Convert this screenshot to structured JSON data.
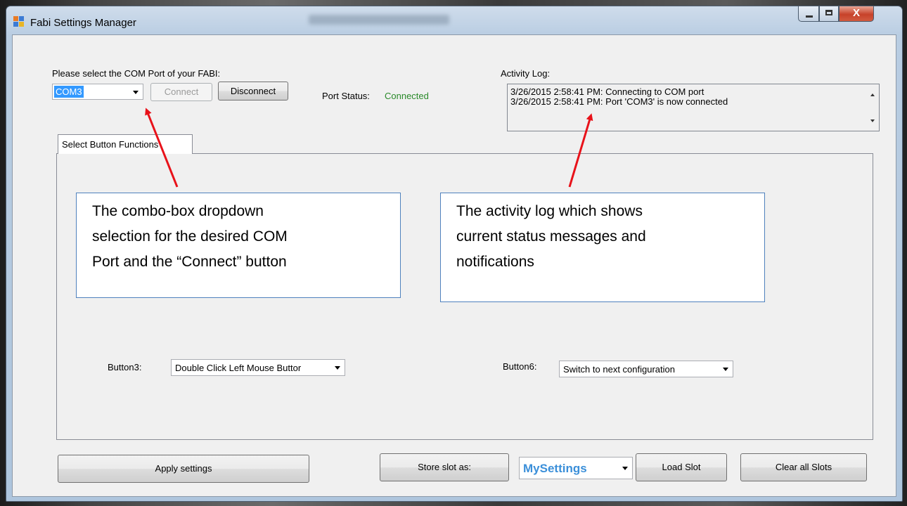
{
  "window": {
    "title": "Fabi Settings Manager",
    "close_glyph": "X"
  },
  "port": {
    "prompt": "Please select the COM Port of your FABI:",
    "selected": "COM3",
    "connect_label": "Connect",
    "disconnect_label": "Disconnect",
    "status_label": "Port Status:",
    "status_value": "Connected",
    "status_color": "#2a8a2a"
  },
  "log": {
    "label": "Activity Log:",
    "lines": [
      "3/26/2015 2:58:41 PM: Connecting to COM port",
      "3/26/2015 2:58:41 PM: Port 'COM3' is now connected"
    ]
  },
  "tabs": [
    {
      "label": "Select Button Functions"
    }
  ],
  "buttons": {
    "button3": {
      "label": "Button3:",
      "value": "Double Click Left Mouse Buttor"
    },
    "button6": {
      "label": "Button6:",
      "value": "Switch to next configuration"
    }
  },
  "callouts": [
    {
      "lines": [
        "The combo-box dropdown",
        "selection for the desired COM",
        "Port and the “Connect” button"
      ]
    },
    {
      "lines": [
        "The activity log which shows",
        "current status messages and",
        "notifications"
      ]
    }
  ],
  "footer": {
    "apply_label": "Apply settings",
    "store_label": "Store slot as:",
    "slot_name": "MySettings",
    "slot_color": "#3b8fd9",
    "load_label": "Load Slot",
    "clear_label": "Clear all Slots"
  },
  "colors": {
    "annotation_arrow": "#e8121a",
    "callout_border": "#4f81bd",
    "selection_highlight": "#3399ff"
  }
}
